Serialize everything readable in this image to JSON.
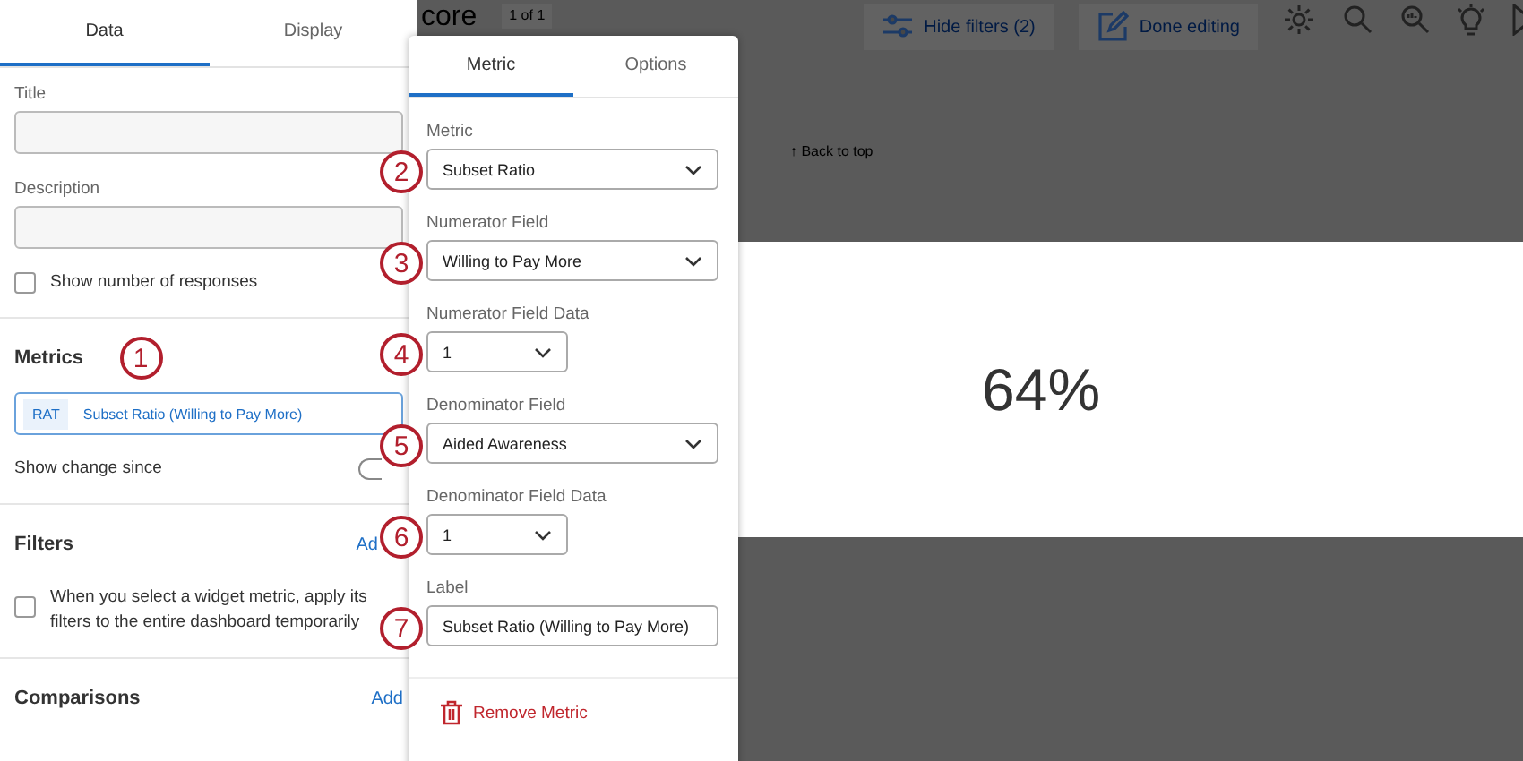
{
  "left_tabs": [
    {
      "label": "Data",
      "selected": true
    },
    {
      "label": "Display",
      "selected": false
    }
  ],
  "title_field": {
    "label": "Title"
  },
  "description_field": {
    "label": "Description"
  },
  "show_responses": {
    "label": "Show number of responses",
    "checked": false
  },
  "metrics": {
    "heading": "Metrics",
    "callout": "1",
    "item": {
      "tag": "RAT",
      "label": "Subset Ratio (Willing to Pay More)"
    },
    "change_label": "Show change since",
    "change_on": false
  },
  "filters": {
    "heading": "Filters",
    "add": "Ad",
    "option": {
      "label": "When you select a widget metric, apply its filters to the entire dashboard temporarily",
      "checked": false
    }
  },
  "comparisons": {
    "heading": "Comparisons",
    "add": "Add"
  },
  "dashboard": {
    "title": "core",
    "page": "1 of 1",
    "hide_filters": "Hide filters (2)",
    "done_editing": "Done editing",
    "back_to_top": "↑ Back to top",
    "value": "64%"
  },
  "popup": {
    "tabs": [
      {
        "label": "Metric",
        "selected": true
      },
      {
        "label": "Options",
        "selected": false
      }
    ],
    "fields": [
      {
        "label": "Metric",
        "kind": "select",
        "value": "Subset Ratio",
        "callout": "2"
      },
      {
        "label": "Numerator Field",
        "kind": "select",
        "value": "Willing to Pay More",
        "callout": "3"
      },
      {
        "label": "Numerator Field Data",
        "kind": "short-select",
        "value": "1",
        "callout": "4"
      },
      {
        "label": "Denominator Field",
        "kind": "select",
        "value": "Aided Awareness",
        "callout": "5"
      },
      {
        "label": "Denominator Field Data",
        "kind": "short-select",
        "value": "1",
        "callout": "6"
      },
      {
        "label": "Label",
        "kind": "text",
        "value": "Subset Ratio (Willing to Pay More)",
        "callout": "7"
      }
    ],
    "remove": "Remove Metric"
  }
}
